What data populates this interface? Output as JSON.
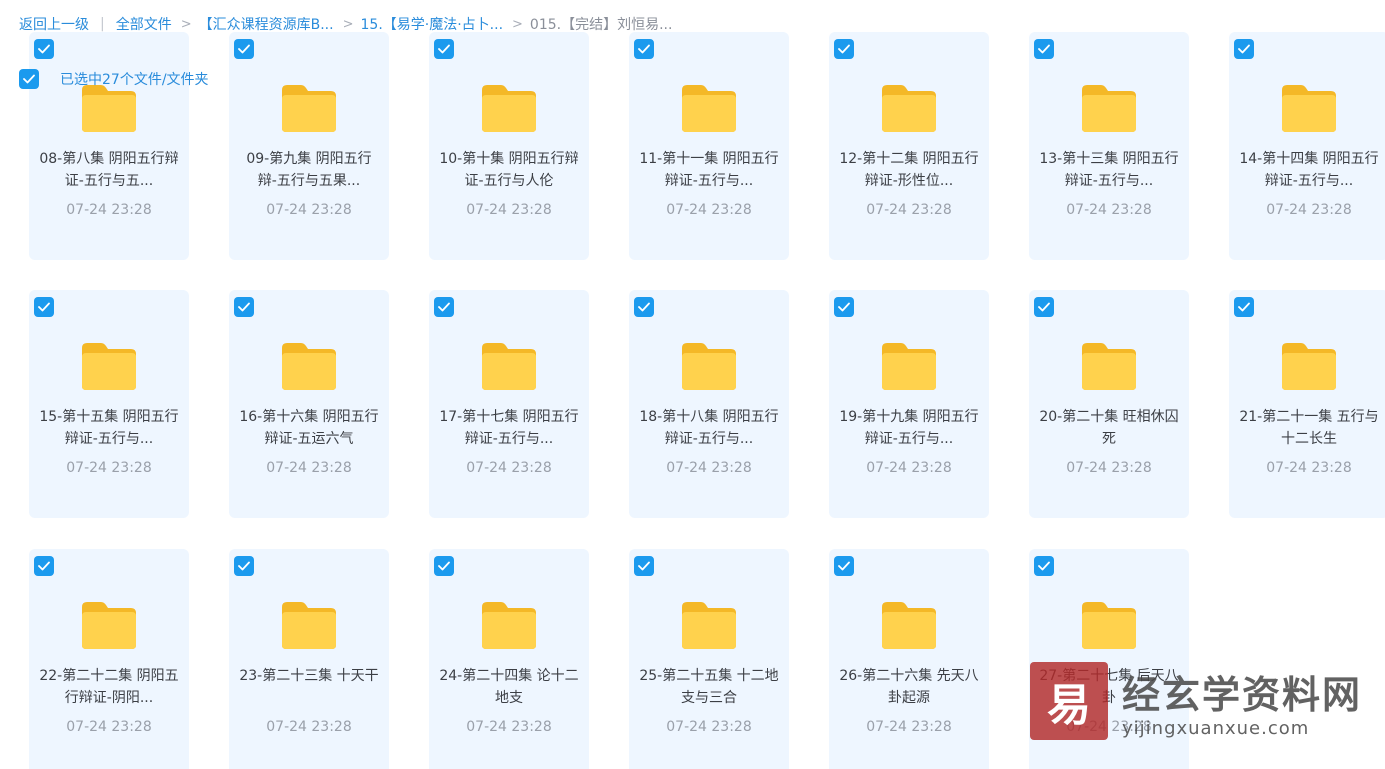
{
  "breadcrumb": {
    "back": "返回上一级",
    "divider": "|",
    "items": [
      "全部文件",
      "【汇众课程资源库B...",
      "15.【易学·魔法·占卜...",
      "015.【完结】刘恒易..."
    ]
  },
  "selection": {
    "label": "已选中27个文件/文件夹",
    "checked": true
  },
  "files": [
    {
      "name": "08-第八集 阴阳五行辩证-五行与五...",
      "date": "07-24 23:28",
      "checked": true
    },
    {
      "name": "09-第九集 阴阳五行辩-五行与五果...",
      "date": "07-24 23:28",
      "checked": true
    },
    {
      "name": "10-第十集 阴阳五行辩证-五行与人伦",
      "date": "07-24 23:28",
      "checked": true
    },
    {
      "name": "11-第十一集 阴阳五行辩证-五行与...",
      "date": "07-24 23:28",
      "checked": true
    },
    {
      "name": "12-第十二集 阴阳五行辩证-形性位...",
      "date": "07-24 23:28",
      "checked": true
    },
    {
      "name": "13-第十三集 阴阳五行辩证-五行与...",
      "date": "07-24 23:28",
      "checked": true
    },
    {
      "name": "14-第十四集 阴阳五行辩证-五行与...",
      "date": "07-24 23:28",
      "checked": true
    },
    {
      "name": "15-第十五集 阴阳五行辩证-五行与...",
      "date": "07-24 23:28",
      "checked": true
    },
    {
      "name": "16-第十六集 阴阳五行辩证-五运六气",
      "date": "07-24 23:28",
      "checked": true
    },
    {
      "name": "17-第十七集 阴阳五行辩证-五行与...",
      "date": "07-24 23:28",
      "checked": true
    },
    {
      "name": "18-第十八集 阴阳五行辩证-五行与...",
      "date": "07-24 23:28",
      "checked": true
    },
    {
      "name": "19-第十九集 阴阳五行辩证-五行与...",
      "date": "07-24 23:28",
      "checked": true
    },
    {
      "name": "20-第二十集 旺相休囚死",
      "date": "07-24 23:28",
      "checked": true
    },
    {
      "name": "21-第二十一集 五行与十二长生",
      "date": "07-24 23:28",
      "checked": true
    },
    {
      "name": "22-第二十二集 阴阳五行辩证-阴阳...",
      "date": "07-24 23:28",
      "checked": true
    },
    {
      "name": "23-第二十三集 十天干",
      "date": "07-24 23:28",
      "checked": true
    },
    {
      "name": "24-第二十四集 论十二地支",
      "date": "07-24 23:28",
      "checked": true
    },
    {
      "name": "25-第二十五集 十二地支与三合",
      "date": "07-24 23:28",
      "checked": true
    },
    {
      "name": "26-第二十六集 先天八卦起源",
      "date": "07-24 23:28",
      "checked": true
    },
    {
      "name": "27-第二十七集 后天八卦",
      "date": "07-24 23:28",
      "checked": true
    }
  ],
  "watermark": {
    "title": "经玄学资料网",
    "url": "yijingxuanxue.com",
    "seal_glyph": "易"
  },
  "colors": {
    "accent": "#1b9aee",
    "tile_bg": "#eef6ff",
    "folder": "#ffd24d"
  }
}
